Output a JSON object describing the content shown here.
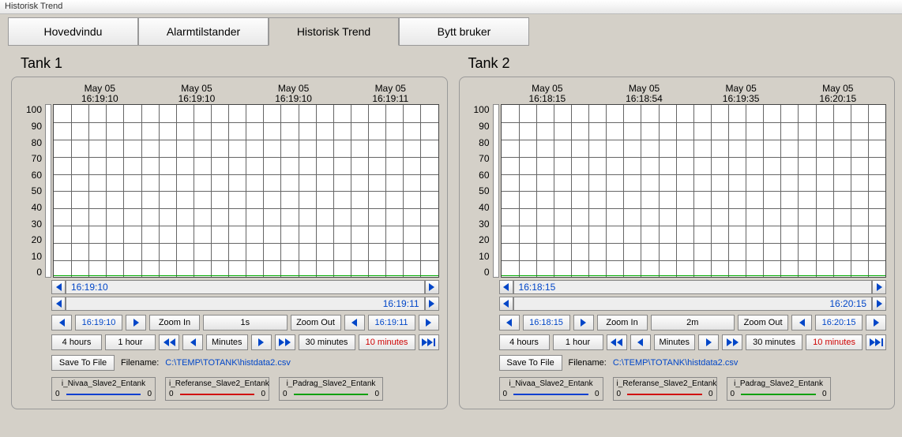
{
  "window_title": "Historisk Trend",
  "tabs": [
    "Hovedvindu",
    "Alarmtilstander",
    "Historisk Trend",
    "Bytt bruker"
  ],
  "active_tab": 2,
  "chart_data": [
    {
      "type": "line",
      "title": "Tank 1",
      "ylim": [
        0,
        100
      ],
      "yticks": [
        0,
        10,
        20,
        30,
        40,
        50,
        60,
        70,
        80,
        90,
        100
      ],
      "xticks": [
        {
          "date": "May 05",
          "time": "16:19:10"
        },
        {
          "date": "May 05",
          "time": "16:19:10"
        },
        {
          "date": "May 05",
          "time": "16:19:10"
        },
        {
          "date": "May 05",
          "time": "16:19:11"
        }
      ],
      "series": [
        {
          "name": "i_Nivaa_Slave2_Entank",
          "color": "blue",
          "value": 0
        },
        {
          "name": "i_Referanse_Slave2_Entank",
          "color": "red",
          "value": 0
        },
        {
          "name": "i_Padrag_Slave2_Entank",
          "color": "green",
          "value": 0
        }
      ],
      "scroll_start": "16:19:10",
      "scroll_end": "16:19:11",
      "nav_start": "16:19:10",
      "nav_end": "16:19:11",
      "zoom_span": "1s",
      "zoom_in_label": "Zoom In",
      "zoom_out_label": "Zoom Out",
      "range_buttons": [
        "4 hours",
        "1 hour"
      ],
      "middle_label": "Minutes",
      "range_buttons2": [
        "30 minutes",
        "10 minutes"
      ],
      "save_label": "Save To File",
      "filename_label": "Filename:",
      "filename_path": "C:\\TEMP\\TOTANK\\histdata2.csv"
    },
    {
      "type": "line",
      "title": "Tank 2",
      "ylim": [
        0,
        100
      ],
      "yticks": [
        0,
        10,
        20,
        30,
        40,
        50,
        60,
        70,
        80,
        90,
        100
      ],
      "xticks": [
        {
          "date": "May 05",
          "time": "16:18:15"
        },
        {
          "date": "May 05",
          "time": "16:18:54"
        },
        {
          "date": "May 05",
          "time": "16:19:35"
        },
        {
          "date": "May 05",
          "time": "16:20:15"
        }
      ],
      "series": [
        {
          "name": "i_Nivaa_Slave2_Entank",
          "color": "blue",
          "value": 0
        },
        {
          "name": "i_Referanse_Slave2_Entank",
          "color": "red",
          "value": 0
        },
        {
          "name": "i_Padrag_Slave2_Entank",
          "color": "green",
          "value": 0
        }
      ],
      "scroll_start": "16:18:15",
      "scroll_end": "16:20:15",
      "nav_start": "16:18:15",
      "nav_end": "16:20:15",
      "zoom_span": "2m",
      "zoom_in_label": "Zoom In",
      "zoom_out_label": "Zoom Out",
      "range_buttons": [
        "4 hours",
        "1 hour"
      ],
      "middle_label": "Minutes",
      "range_buttons2": [
        "30 minutes",
        "10 minutes"
      ],
      "save_label": "Save To File",
      "filename_label": "Filename:",
      "filename_path": "C:\\TEMP\\TOTANK\\histdata2.csv"
    }
  ]
}
